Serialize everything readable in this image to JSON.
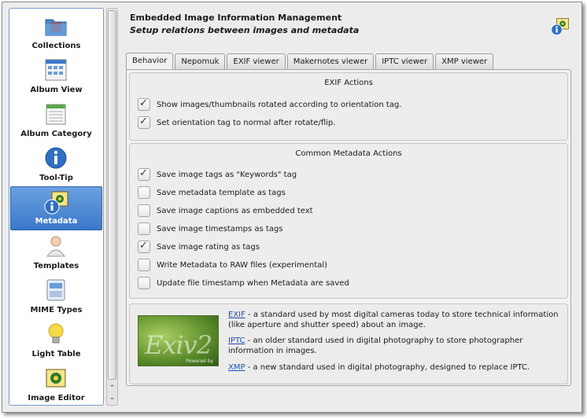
{
  "sidebar": {
    "items": [
      {
        "label": "Collections",
        "icon": "collections-folder-icon"
      },
      {
        "label": "Album View",
        "icon": "album-view-icon"
      },
      {
        "label": "Album Category",
        "icon": "album-category-icon"
      },
      {
        "label": "Tool-Tip",
        "icon": "info-icon"
      },
      {
        "label": "Metadata",
        "icon": "metadata-icon",
        "selected": true
      },
      {
        "label": "Templates",
        "icon": "templates-person-icon"
      },
      {
        "label": "MIME Types",
        "icon": "mime-types-icon"
      },
      {
        "label": "Light Table",
        "icon": "light-table-bulb-icon"
      },
      {
        "label": "Image Editor",
        "icon": "image-editor-icon"
      }
    ]
  },
  "header": {
    "title": "Embedded Image Information Management",
    "subtitle": "Setup relations between images and metadata",
    "icon": "metadata-icon"
  },
  "tabs": [
    "Behavior",
    "Nepomuk",
    "EXIF viewer",
    "Makernotes viewer",
    "IPTC viewer",
    "XMP viewer"
  ],
  "active_tab": "Behavior",
  "exif_actions": {
    "title": "EXIF Actions",
    "items": [
      {
        "label": "Show images/thumbnails rotated according to orientation tag.",
        "checked": true
      },
      {
        "label": "Set orientation tag to normal after rotate/flip.",
        "checked": true
      }
    ]
  },
  "common_actions": {
    "title": "Common Metadata Actions",
    "items": [
      {
        "label": "Save image tags as \"Keywords\" tag",
        "checked": true
      },
      {
        "label": "Save metadata template as tags",
        "checked": false
      },
      {
        "label": "Save image captions as embedded text",
        "checked": false
      },
      {
        "label": "Save image timestamps as tags",
        "checked": false
      },
      {
        "label": "Save image rating as tags",
        "checked": true
      },
      {
        "label": "Write Metadata to RAW files (experimental)",
        "checked": false
      },
      {
        "label": "Update file timestamp when Metadata are saved",
        "checked": false
      }
    ]
  },
  "info": {
    "logo_text": "Exiv2",
    "logo_caption": "Powered by",
    "exif_link": "EXIF",
    "exif_text": " - a standard used by most digital cameras today to store technical information (like aperture and shutter speed) about an image.",
    "iptc_link": "IPTC",
    "iptc_text": " - an older standard used in digital photography to store photographer information in images.",
    "xmp_link": "XMP",
    "xmp_text": " - a new standard used in digital photography, designed to replace IPTC."
  }
}
